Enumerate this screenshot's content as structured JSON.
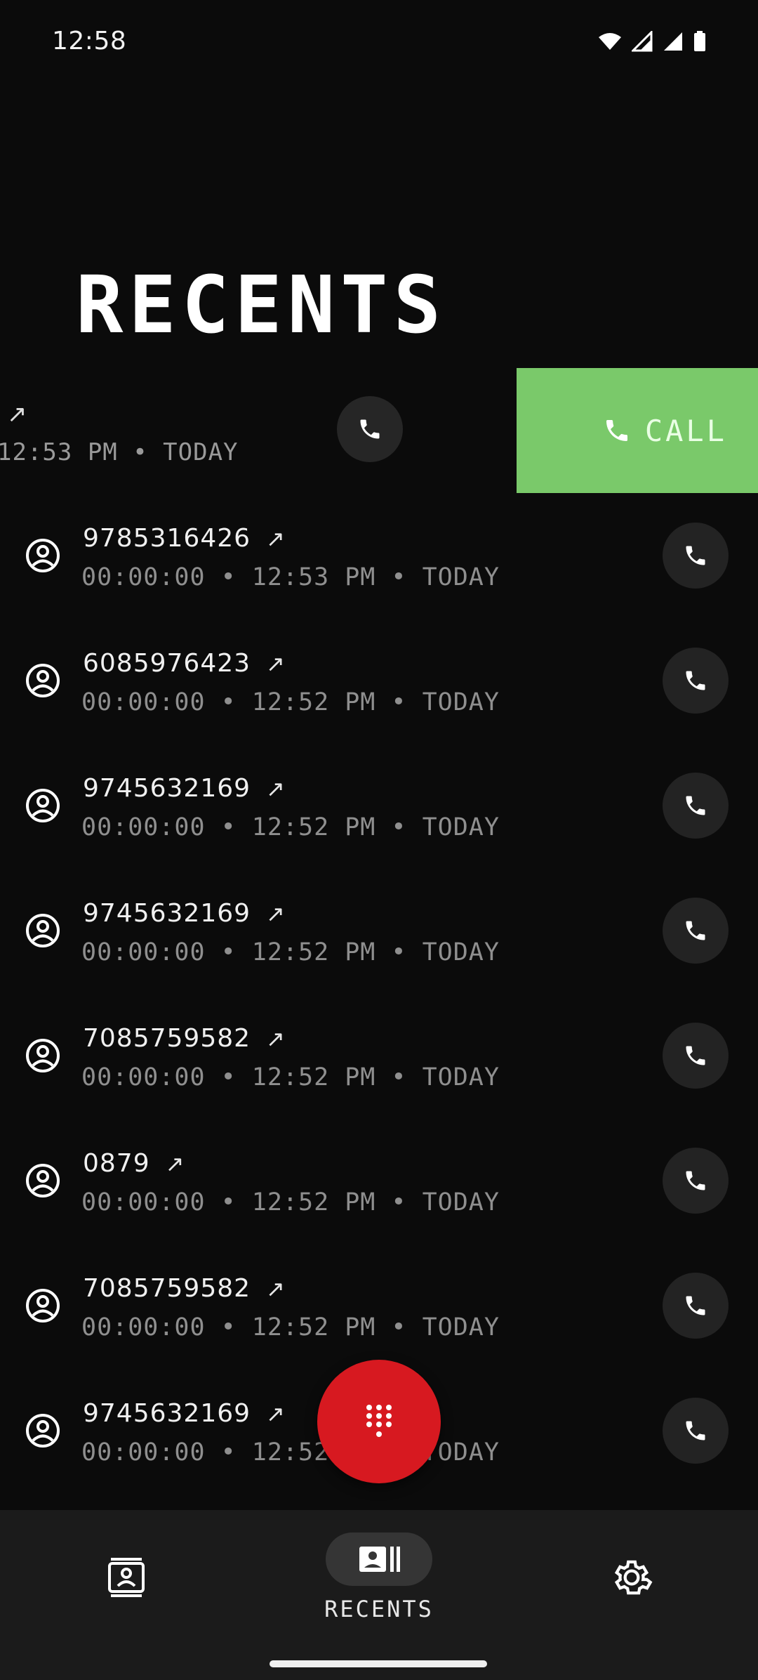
{
  "status_bar": {
    "time": "12:58"
  },
  "page": {
    "title": "RECENTS"
  },
  "swipe_row": {
    "meta": "12:53 PM • TODAY",
    "action_label": "CALL",
    "action_color": "#7ac96a"
  },
  "calls": [
    {
      "number": "9785316426",
      "meta": "00:00:00 • 12:53 PM • TODAY"
    },
    {
      "number": "6085976423",
      "meta": "00:00:00 • 12:52 PM • TODAY"
    },
    {
      "number": "9745632169",
      "meta": "00:00:00 • 12:52 PM • TODAY"
    },
    {
      "number": "9745632169",
      "meta": "00:00:00 • 12:52 PM • TODAY"
    },
    {
      "number": "7085759582",
      "meta": "00:00:00 • 12:52 PM • TODAY"
    },
    {
      "number": "0879",
      "meta": "00:00:00 • 12:52 PM • TODAY"
    },
    {
      "number": "7085759582",
      "meta": "00:00:00 • 12:52 PM • TODAY"
    },
    {
      "number": "9745632169",
      "meta": "00:00:00 • 12:52 PM • TODAY"
    }
  ],
  "call_direction_icon": "outgoing-arrow-icon",
  "fab": {
    "icon": "dialpad-icon",
    "color": "#d71920"
  },
  "bottom_nav": {
    "items": [
      {
        "icon": "contacts-icon"
      },
      {
        "icon": "recents-icon",
        "label": "RECENTS",
        "active": true
      },
      {
        "icon": "gear-icon"
      }
    ]
  }
}
